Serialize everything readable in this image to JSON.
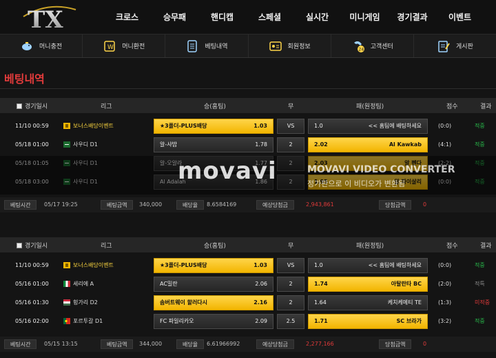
{
  "logo_text": "TX",
  "nav": [
    "크로스",
    "승무패",
    "핸디캡",
    "스페셜",
    "실시간",
    "미니게임",
    "경기결과",
    "이벤트"
  ],
  "subnav": [
    {
      "label": "머니충전",
      "icon": "piggy-bank-icon"
    },
    {
      "label": "머니환전",
      "icon": "exchange-icon"
    },
    {
      "label": "베팅내역",
      "icon": "betting-list-icon"
    },
    {
      "label": "회원정보",
      "icon": "member-card-icon"
    },
    {
      "label": "고객센터",
      "icon": "support-24-icon"
    },
    {
      "label": "게시판",
      "icon": "board-icon"
    }
  ],
  "page_title": "베팅내역",
  "columns": {
    "date": "경기일시",
    "league": "리그",
    "home": "승(홈팀)",
    "draw": "무",
    "away": "패(원정팀)",
    "score": "점수",
    "result": "결과"
  },
  "summary_labels": {
    "bet_time": "베팅시간",
    "bet_amount": "베팅금액",
    "odds": "배당율",
    "expected": "예상당첨금",
    "win": "당첨금액"
  },
  "bets": [
    {
      "rows": [
        {
          "date": "11/10 00:59",
          "league": "보너스배당이벤트",
          "flag": "event",
          "home": "★3폴더-PLUS배당",
          "home_odd": "1.03",
          "mid": "VS",
          "away_odd": "1.0",
          "away": "<< 홈팀에 배팅하세요",
          "selected": "home",
          "score": "(0:0)",
          "result": "적중",
          "result_color": "green"
        },
        {
          "date": "05/18 01:00",
          "league": "사우디 D1",
          "flag": "saudi",
          "home": "알-샤밥",
          "home_odd": "1.78",
          "mid": "2",
          "away_odd": "2.02",
          "away": "Al Kawkab",
          "selected": "away",
          "score": "(4:1)",
          "result": "적중",
          "result_color": "green"
        },
        {
          "date": "05/18 01:05",
          "league": "사우디 D1",
          "flag": "saudi",
          "home": "알-오알라",
          "home_odd": "1.77",
          "mid": "2",
          "away_odd": "2.03",
          "away": "알 펜다",
          "selected": "away",
          "score": "(2:2)",
          "result": "적중",
          "result_color": "green"
        },
        {
          "date": "05/18 03:00",
          "league": "사우디 D1",
          "flag": "saudi",
          "home": "Al Adalah",
          "home_odd": "1.86",
          "mid": "2",
          "away_odd": "1.95",
          "away": "알 파이살리",
          "selected": "away",
          "score": "(0:0)",
          "result": "적중",
          "result_color": "green"
        }
      ],
      "summary": {
        "bet_time": "05/17 19:25",
        "bet_amount": "340,000",
        "odds": "8.6584169",
        "expected": "2,943,861",
        "win": "0"
      }
    },
    {
      "rows": [
        {
          "date": "11/10 00:59",
          "league": "보너스배당이벤트",
          "flag": "event",
          "home": "★3폴더-PLUS배당",
          "home_odd": "1.03",
          "mid": "VS",
          "away_odd": "1.0",
          "away": "<< 홈팀에 배팅하세요",
          "selected": "home",
          "score": "(0:0)",
          "result": "적중",
          "result_color": "green"
        },
        {
          "date": "05/16 01:00",
          "league": "세리에 A",
          "flag": "italy",
          "home": "AC밀란",
          "home_odd": "2.06",
          "mid": "2",
          "away_odd": "1.74",
          "away": "아탈란타 BC",
          "selected": "away",
          "score": "(2:0)",
          "result": "적특",
          "result_color": "gray"
        },
        {
          "date": "05/16 01:30",
          "league": "헝가리 D2",
          "flag": "hungary",
          "home": "솜버트웨이 할러다시",
          "home_odd": "2.16",
          "mid": "2",
          "away_odd": "1.64",
          "away": "케치케메티 TE",
          "selected": "home",
          "score": "(1:3)",
          "result": "미적중",
          "result_color": "red"
        },
        {
          "date": "05/16 02:00",
          "league": "포르투갈 D1",
          "flag": "portugal",
          "home": "FC 파일리카오",
          "home_odd": "2.09",
          "mid": "2.5",
          "away_odd": "1.71",
          "away": "SC 브라가",
          "selected": "away",
          "score": "(3:2)",
          "result": "적중",
          "result_color": "green"
        }
      ],
      "summary": {
        "bet_time": "05/15 13:15",
        "bet_amount": "344,000",
        "odds": "6.61966992",
        "expected": "2,277,166",
        "win": "0"
      }
    }
  ],
  "watermark": {
    "brand": "movavi",
    "title": "MOVAVI VIDEO CONVERTER",
    "subtitle": "정가판으로 이 비디오가 변환됨"
  },
  "colors": {
    "accent": "#f2b500",
    "title_red": "#e23b3b",
    "win_green": "#28b84a",
    "lose_red": "#e03a3a"
  }
}
